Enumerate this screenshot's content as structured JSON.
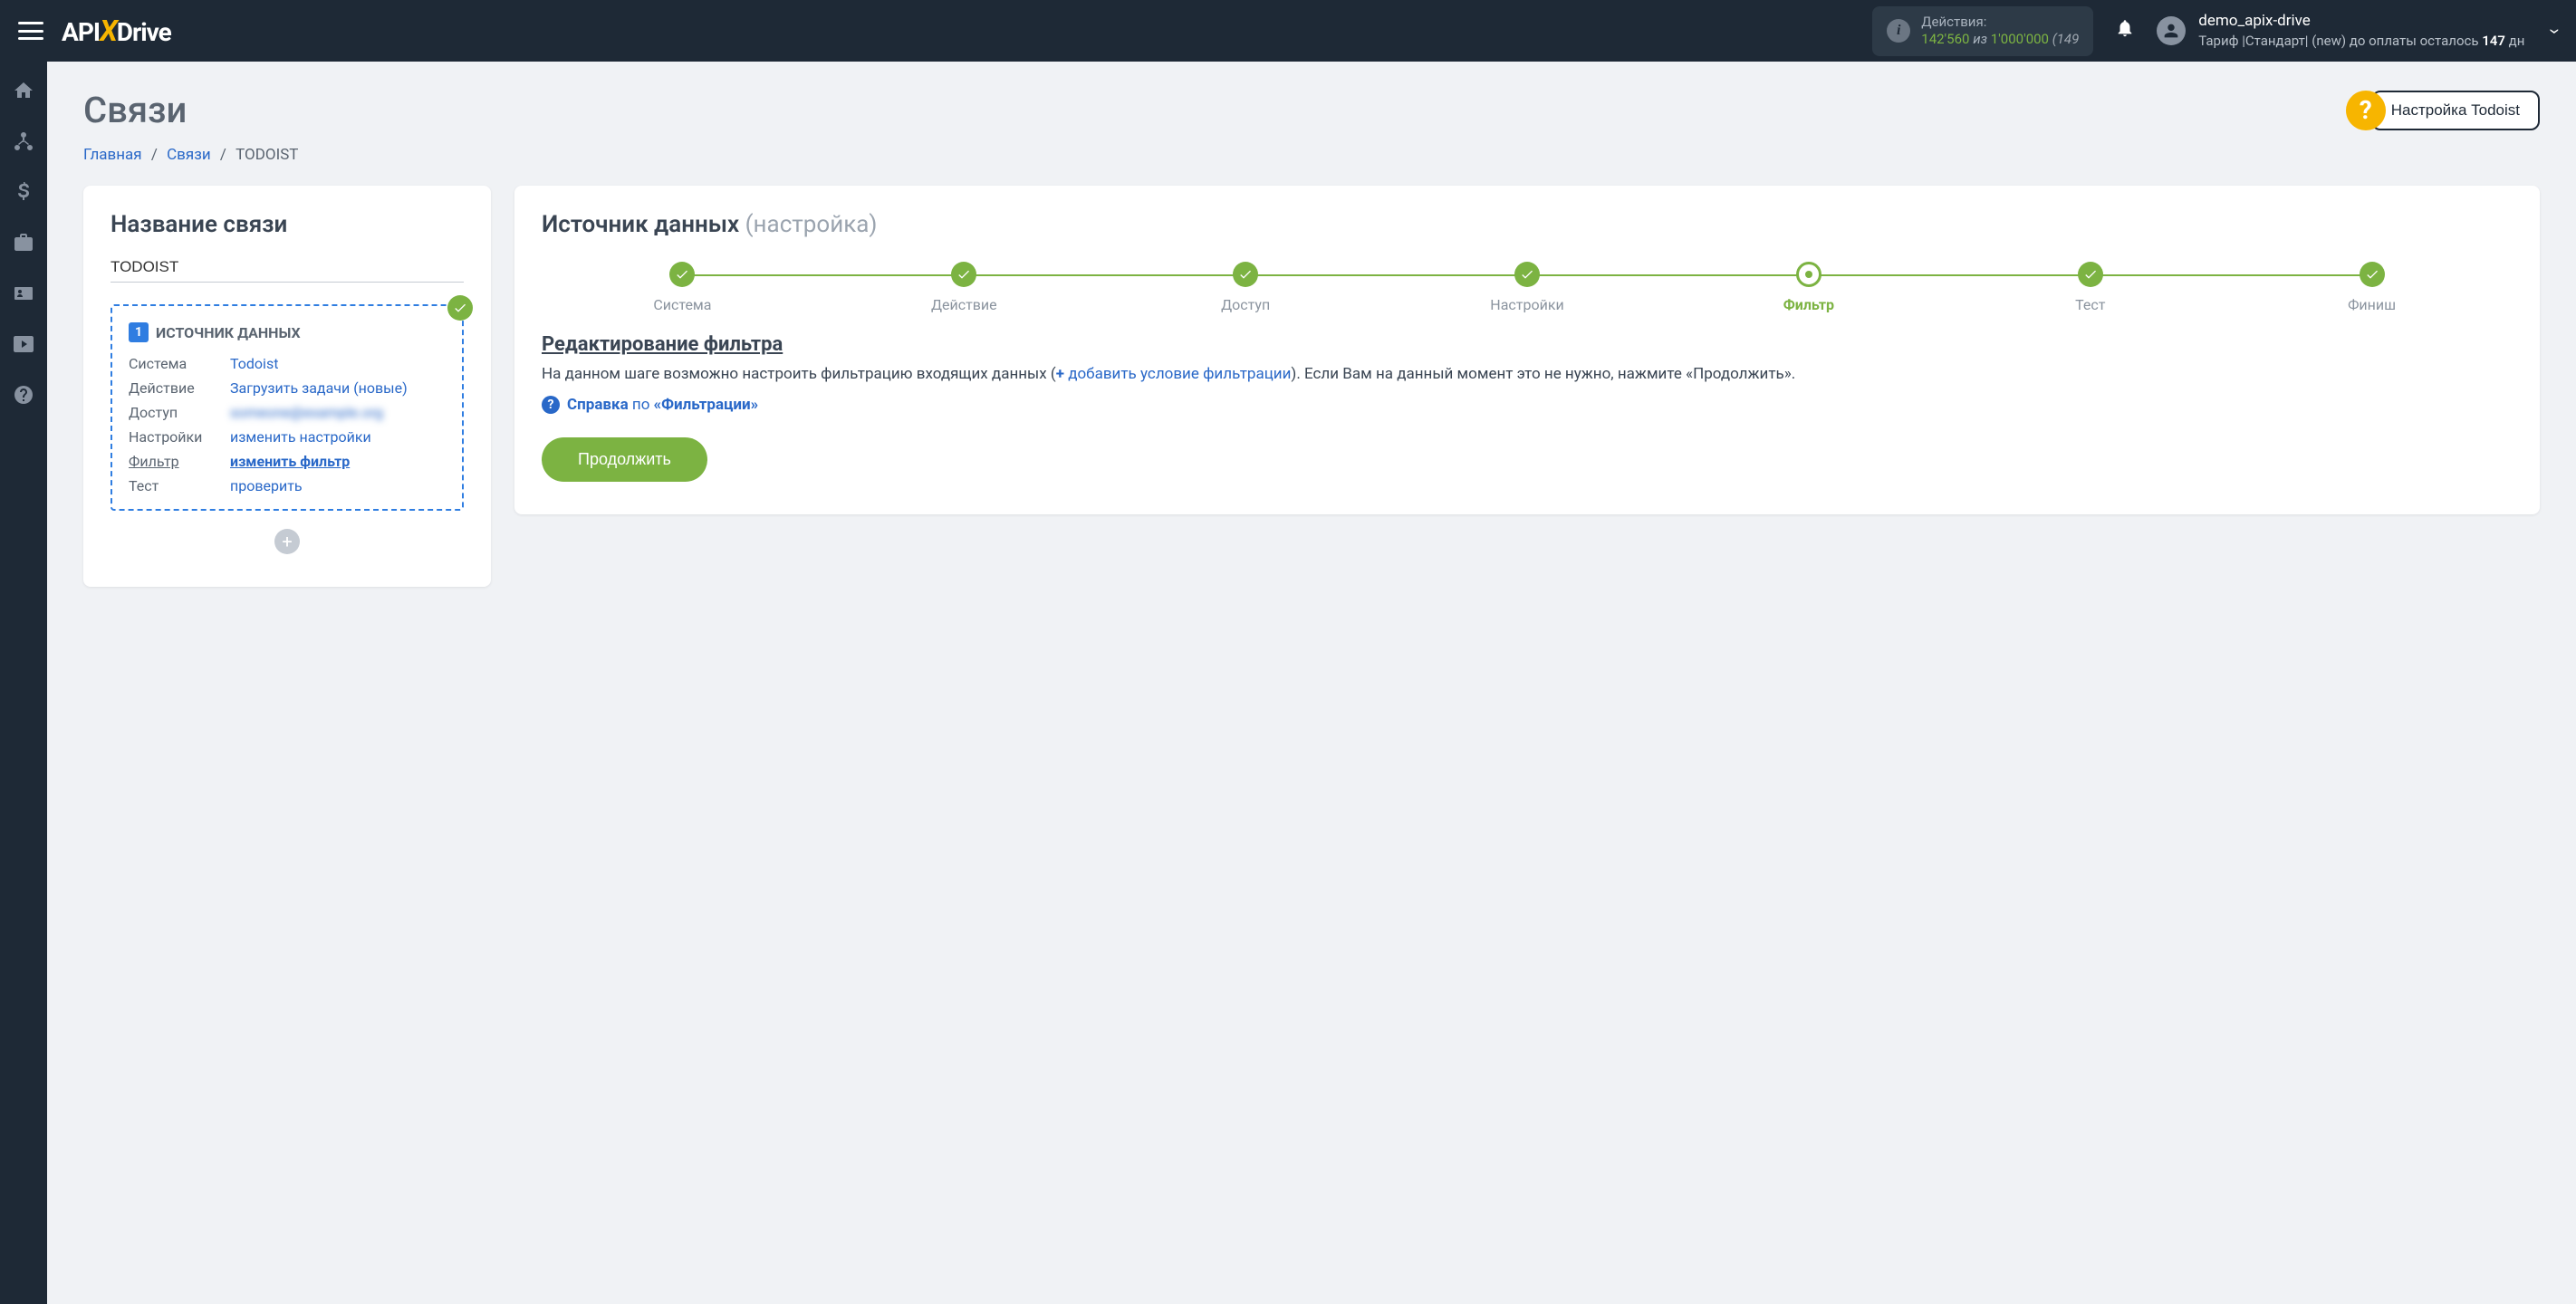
{
  "header": {
    "actions_label": "Действия:",
    "actions_current": "142'560",
    "actions_iz": "из",
    "actions_total": "1'000'000",
    "actions_trunc": "(149",
    "user_name": "demo_apix-drive",
    "tariff_prefix": "Тариф |Стандарт| (new) до оплаты осталось ",
    "tariff_days": "147",
    "tariff_suffix": " дн"
  },
  "page": {
    "title": "Связи",
    "breadcrumb_home": "Главная",
    "breadcrumb_links": "Связи",
    "breadcrumb_current": "TODOIST",
    "setup_button": "Настройка Todoist"
  },
  "left_card": {
    "title": "Название связи",
    "input_value": "TODOIST",
    "box_title": "ИСТОЧНИК ДАННЫХ",
    "box_num": "1",
    "rows": {
      "system_label": "Система",
      "system_value": "Todoist",
      "action_label": "Действие",
      "action_value": "Загрузить задачи (новые)",
      "access_label": "Доступ",
      "access_value": "someone@example.org",
      "settings_label": "Настройки",
      "settings_value": "изменить настройки",
      "filter_label": "Фильтр",
      "filter_value": "изменить фильтр",
      "test_label": "Тест",
      "test_value": "проверить"
    }
  },
  "right_card": {
    "title": "Источник данных",
    "subtitle": "(настройка)",
    "steps": [
      "Система",
      "Действие",
      "Доступ",
      "Настройки",
      "Фильтр",
      "Тест",
      "Финиш"
    ],
    "current_step_index": 4,
    "filter_heading": "Редактирование фильтра",
    "desc_1": "На данном шаге возможно настроить фильтрацию входящих данных (",
    "add_link": "добавить условие фильтрации",
    "desc_2": "). Если Вам на данный момент это не нужно, нажмите «Продолжить».",
    "help_prefix": "Справка",
    "help_mid": " по ",
    "help_strong": "«Фильтрации»",
    "continue": "Продолжить"
  }
}
